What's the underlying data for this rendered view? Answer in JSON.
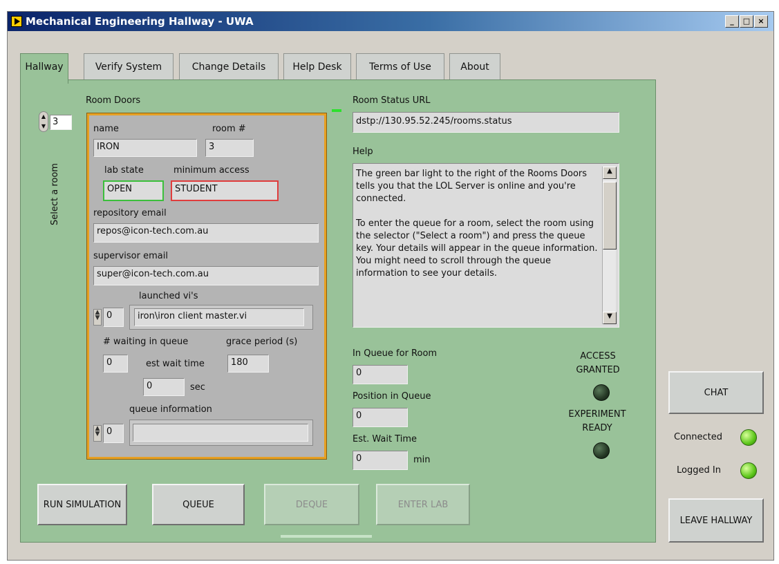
{
  "window": {
    "title": "Mechanical Engineering Hallway - UWA"
  },
  "tabs": [
    {
      "label": "Hallway"
    },
    {
      "label": "Verify System"
    },
    {
      "label": "Change Details"
    },
    {
      "label": "Help Desk"
    },
    {
      "label": "Terms of Use"
    },
    {
      "label": "About"
    }
  ],
  "room_doors": {
    "title": "Room Doors",
    "selector_value": "3",
    "selector_label": "Select a room",
    "name_label": "name",
    "name_value": "IRON",
    "room_label": "room #",
    "room_value": "3",
    "lab_state_label": "lab state",
    "lab_state_value": "OPEN",
    "min_access_label": "minimum access",
    "min_access_value": "STUDENT",
    "repo_email_label": "repository email",
    "repo_email_value": "repos@icon-tech.com.au",
    "super_email_label": "supervisor email",
    "super_email_value": "super@icon-tech.com.au",
    "launched_label": "launched vi's",
    "launched_index": "0",
    "launched_value": "iron\\iron client master.vi",
    "waiting_label": "# waiting in queue",
    "waiting_value": "0",
    "grace_label": "grace period (s)",
    "grace_value": "180",
    "est_wait_label": "est wait time",
    "est_wait_value": "0",
    "sec_label": "sec",
    "queue_info_label": "queue information",
    "queue_info_index": "0",
    "queue_info_value": ""
  },
  "status": {
    "url_label": "Room Status URL",
    "url_value": "dstp://130.95.52.245/rooms.status",
    "help_label": "Help",
    "help_text_1": "The green bar light to the right of the Rooms Doors tells you that the LOL Server is online and you're connected.",
    "help_text_2": "To enter the queue for a room, select the room using the selector (\"Select a room\") and press the queue key. Your details will appear in the queue information. You might need to scroll through the queue information to see your details.",
    "in_queue_label": "In Queue for Room",
    "in_queue_value": "0",
    "position_label": "Position in Queue",
    "position_value": "0",
    "est_label": "Est. Wait Time",
    "est_value": "0",
    "min_label": "min",
    "access_granted_label": "ACCESS GRANTED",
    "experiment_ready_label": "EXPERIMENT READY"
  },
  "buttons": {
    "run_simulation": "RUN SIMULATION",
    "queue": "QUEUE",
    "deque": "DEQUE",
    "enter_lab": "ENTER LAB",
    "chat": "CHAT",
    "leave_hallway": "LEAVE HALLWAY"
  },
  "indicators": {
    "connected_label": "Connected",
    "logged_in_label": "Logged In"
  },
  "colors": {
    "panel_green": "#99c299",
    "led_on": "#5cc61a",
    "led_off": "#253825",
    "frame_orange": "#e6a023"
  }
}
